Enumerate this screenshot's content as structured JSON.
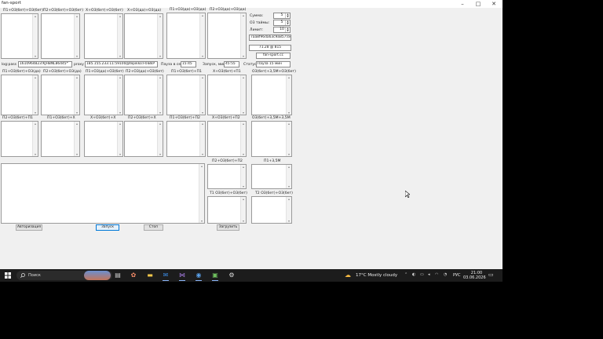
{
  "window": {
    "title": "fan-sport",
    "minimize": "–",
    "maximize": "□",
    "close": "✕"
  },
  "top_labels": [
    "П1+О3(бет)+О3(бет)",
    "П2+О3(бет)+О3(бет)",
    "Х+О3(бет)+О3(бет)",
    "Х+О3(да)+О3(да)",
    "П1+О3(да)+О3(да)",
    "П2+О3(да)+О3(да)"
  ],
  "settings": {
    "summa_label": "Сумма:",
    "summa_value": "5",
    "oz_label": "О3 таймы:",
    "oz_value": "5",
    "limit_label": "Лимит:",
    "limit_value": "10",
    "hash": "7aa8f96da63c9a857ззee",
    "balance": "71.28 @ 815",
    "site": "fan-sport.cc"
  },
  "login_row": {
    "logpass_label": "log:pass",
    "logpass_value": "1610964823:KJHBNL86445*",
    "proxy_label": "proxy",
    "proxy_value": "185.155.233.11:59100@tepikko:F0iBkP",
    "pause_label": "Пауза в сек",
    "pause_value": "15:45",
    "launch_label": "Запуск, мин",
    "launch_value": "45:55",
    "status_label": "Статус:",
    "status_value": "Пауза 15 мин"
  },
  "row2_labels": [
    "П1+О3(бет)+О3(да)",
    "П2+О3(бет)+О3(да)",
    "П1+О3(да)+О3(бет)",
    "П2+О3(да)+О3(бет)",
    "П1+О3(бет)+П1",
    "Х+О3(бет)+П1",
    "О3(бет)+3,5М+О3(бет)"
  ],
  "row3_labels": [
    "П2+О3(бет)+П1",
    "П1+О3(бет)+Х",
    "Х+О3(бет)+Х",
    "П2+О3(бет)+Х",
    "П1+О3(бет)+П2",
    "Х+О3(бет)+П2",
    "О3(бет)+3,5М+3,5М"
  ],
  "lower_labels": {
    "p2": "П2+О3(бет)+П2",
    "p1_35": "П1+3,5М",
    "t1": "Т1  О3(бет)+О3(бет)",
    "t2": "Т2  О3(бет)+О3(бет)"
  },
  "buttons": {
    "auth": "Авторизация",
    "start": "Запуск",
    "stop": "Стоп",
    "load": "Загрузить"
  },
  "taskbar": {
    "search_placeholder": "Поиск",
    "weather": "17°C  Mostly cloudy",
    "lang": "РУС",
    "time": "21:00",
    "date": "03.06.2026"
  }
}
